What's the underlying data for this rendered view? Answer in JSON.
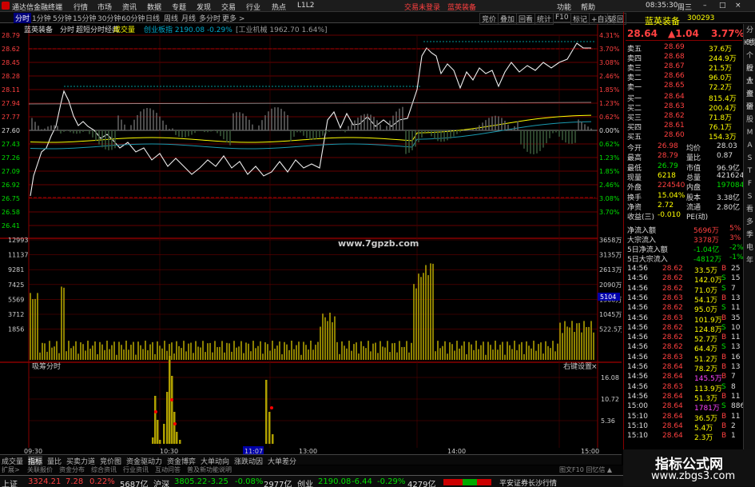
{
  "window": {
    "title": "通达信金融终端",
    "menus": [
      "行情",
      "市场",
      "资讯",
      "数据",
      "专题",
      "发现",
      "交易",
      "行业",
      "热点",
      "L1L2"
    ],
    "trade_notice": "交易未登录",
    "stock_name_top": "蓝英装备",
    "right_menus": [
      "功能",
      "帮助"
    ],
    "clock": "08:35:30",
    "weekday": "周三",
    "controls": [
      "–",
      "□",
      "×"
    ]
  },
  "toolbar": {
    "periods": [
      "分时",
      "1分钟",
      "5分钟",
      "15分钟",
      "30分钟",
      "60分钟",
      "日线",
      "周线",
      "月线",
      "多分时",
      "更多 >"
    ],
    "right": [
      "竞价",
      "叠加",
      "回看",
      "统计",
      "F10",
      "标记",
      "+自选",
      "返回"
    ]
  },
  "chart": {
    "header_name": "蓝英装备",
    "header_fenshi": "分时",
    "header_style": "超短分时经典",
    "header_vol": "成交量",
    "header_index": "创业板指 2190.08 -0.29%",
    "header_industry": "[工业机械 1962.70 1.64%]",
    "price_labels": [
      "28.79",
      "28.62",
      "28.45",
      "28.28",
      "28.11",
      "27.94",
      "27.77",
      "27.60",
      "27.43",
      "27.26",
      "27.09",
      "26.92",
      "26.75",
      "26.58",
      "26.41"
    ],
    "pct_labels": [
      "4.31%",
      "3.70%",
      "3.08%",
      "2.46%",
      "1.85%",
      "1.23%",
      "0.62%",
      "0.00%",
      "0.62%",
      "1.23%",
      "1.85%",
      "2.46%",
      "3.08%",
      "3.70%"
    ],
    "vol_labels": [
      "12993",
      "11137",
      "9281",
      "7425",
      "5569",
      "3712",
      "1856"
    ],
    "vol_right": [
      "3658万",
      "3135万",
      "2613万",
      "2090万",
      "1568万",
      "1045万",
      "522.5万"
    ],
    "vol_current": "5104",
    "chip_title": "吸筹分时",
    "chip_right": "右键设置",
    "chip_close": "×",
    "chip_labels": [
      "16.08",
      "10.72",
      "5.36"
    ],
    "time_labels": [
      "09:30",
      "10:30",
      "11:07",
      "13:00",
      "14:00",
      "15:00"
    ],
    "watermark_url": "www.7gpzb.com"
  },
  "panel": {
    "name": "蓝英装备",
    "code": "300293",
    "price": "28.64",
    "change": "▲1.04",
    "pct": "3.77%",
    "asks": [
      [
        "卖五",
        "28.69",
        "37.6万"
      ],
      [
        "卖四",
        "28.68",
        "244.9万"
      ],
      [
        "卖三",
        "28.67",
        "21.5万"
      ],
      [
        "卖二",
        "28.66",
        "96.0万"
      ],
      [
        "卖一",
        "28.65",
        "72.2万"
      ]
    ],
    "bids": [
      [
        "买一",
        "28.64",
        "815.4万"
      ],
      [
        "买二",
        "28.63",
        "200.4万"
      ],
      [
        "买三",
        "28.62",
        "71.8万"
      ],
      [
        "买四",
        "28.61",
        "76.1万"
      ],
      [
        "买五",
        "28.60",
        "154.3万"
      ]
    ],
    "stats": [
      [
        "今开",
        "26.98",
        "均价",
        "28.03"
      ],
      [
        "最高",
        "28.79",
        "量比",
        "0.87"
      ],
      [
        "最低",
        "26.79",
        "市值",
        "96.9亿"
      ],
      [
        "现量",
        "6218",
        "总量",
        "421624"
      ],
      [
        "外盘",
        "224540",
        "内盘",
        "197084"
      ],
      [
        "换手",
        "15.04%",
        "股本",
        "3.38亿"
      ],
      [
        "净资",
        "2.72",
        "流通",
        "2.80亿"
      ],
      [
        "收益(三)",
        "-0.010",
        "PE(动)",
        ""
      ]
    ],
    "flows": [
      [
        "净流入额",
        "5696万",
        "5%"
      ],
      [
        "大宗流入",
        "3378万",
        "3%"
      ],
      [
        "5日净流入额",
        "-1.04亿",
        "-2%"
      ],
      [
        "5日大宗流入",
        "-4812万",
        "-1%"
      ]
    ],
    "ticks": [
      [
        "14:56",
        "28.62",
        "33.5万",
        "B",
        "25"
      ],
      [
        "14:56",
        "28.62",
        "142.0万",
        "S",
        "15"
      ],
      [
        "14:56",
        "28.62",
        "71.0万",
        "S",
        "7"
      ],
      [
        "14:56",
        "28.63",
        "54.1万",
        "B",
        "13"
      ],
      [
        "14:56",
        "28.62",
        "95.0万",
        "S",
        "11"
      ],
      [
        "14:56",
        "28.63",
        "101.9万",
        "B",
        "35"
      ],
      [
        "14:56",
        "28.62",
        "124.8万",
        "S",
        "10"
      ],
      [
        "14:56",
        "28.62",
        "52.7万",
        "B",
        "11"
      ],
      [
        "14:56",
        "28.62",
        "64.4万",
        "S",
        "13"
      ],
      [
        "14:56",
        "28.63",
        "51.2万",
        "B",
        "16"
      ],
      [
        "14:56",
        "28.64",
        "78.2万",
        "B",
        "13"
      ],
      [
        "14:56",
        "28.64",
        "145.5万",
        "B",
        "7"
      ],
      [
        "14:56",
        "28.63",
        "113.9万",
        "S",
        "8"
      ],
      [
        "14:56",
        "28.64",
        "51.3万",
        "B",
        "11"
      ],
      [
        "15:00",
        "28.64",
        "1781万",
        "S",
        "886"
      ],
      [
        "15:10",
        "28.64",
        "36.5万",
        "B",
        "11"
      ],
      [
        "15:10",
        "28.64",
        "5.4万",
        "B",
        "2"
      ],
      [
        "15:10",
        "28.64",
        "2.3万",
        "B",
        "1"
      ]
    ]
  },
  "sidebar": [
    "分时",
    "K线",
    "个股",
    "行业",
    "大盘",
    "资金",
    "研",
    "股",
    "M",
    "A",
    "S",
    "T",
    "F",
    "S",
    "看",
    "多",
    "季",
    "电",
    "年"
  ],
  "bottomtabs": [
    "成交量",
    "指标",
    "量比",
    "买卖力道",
    "竞价图",
    "资金驱动力",
    "资金博弈",
    "大单动向",
    "涨跌动因",
    "大单差分"
  ],
  "subtabs": [
    "扩展>",
    "关联报价",
    "资金分布",
    "综合资讯",
    "行业资讯",
    "互动问答",
    "普及新功能说明"
  ],
  "subtabs_right": "图文F10 回忆信 ▲",
  "status": {
    "sh_label": "上证",
    "sh_val": "3324.21",
    "sh_chg": "7.28",
    "sh_pct": "0.22%",
    "sh_amt": "5687亿",
    "sz_label": "沪深",
    "sz_val": "3805.22",
    "sz_chg": "-3.25",
    "sz_pct": "-0.08%",
    "sz_amt": "2977亿",
    "cy_label": "创业",
    "cy_val": "2190.08",
    "cy_chg": "-6.44",
    "cy_pct": "-0.29%",
    "cy_amt": "4279亿",
    "broker": "平安证券长沙行情"
  },
  "watermark": {
    "title": "指标公式网",
    "url": "www.zbgs3.com"
  },
  "chip_bars": [
    [
      190,
      8
    ],
    [
      193,
      60
    ],
    [
      196,
      30
    ],
    [
      199,
      5
    ],
    [
      204,
      25
    ],
    [
      208,
      65
    ],
    [
      211,
      110
    ],
    [
      214,
      85
    ],
    [
      217,
      40
    ],
    [
      220,
      15
    ],
    [
      224,
      5
    ],
    [
      332,
      80
    ],
    [
      336,
      40
    ],
    [
      340,
      12
    ]
  ]
}
